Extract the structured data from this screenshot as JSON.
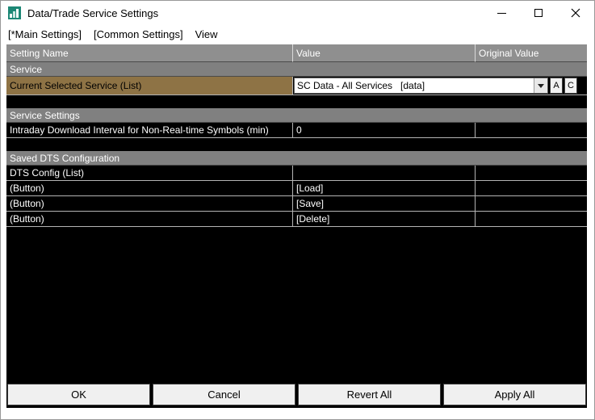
{
  "window": {
    "title": "Data/Trade Service Settings"
  },
  "menu": {
    "items": [
      {
        "label": "[*Main Settings]"
      },
      {
        "label": "[Common Settings]"
      },
      {
        "label": "View"
      }
    ]
  },
  "table": {
    "columns": [
      "Setting Name",
      "Value",
      "Original Value"
    ],
    "rows": [
      {
        "type": "section",
        "label": "Service"
      },
      {
        "type": "setting",
        "name": "Current Selected Service (List)",
        "control": "dropdown",
        "value": "SC Data - All Services   [data]",
        "aux_buttons": [
          "A",
          "C"
        ],
        "original": "",
        "selected": true
      },
      {
        "type": "spacer"
      },
      {
        "type": "section",
        "label": "Service Settings"
      },
      {
        "type": "setting",
        "name": "Intraday Download Interval for Non-Real-time Symbols (min)",
        "value": "0",
        "original": ""
      },
      {
        "type": "spacer"
      },
      {
        "type": "section",
        "label": "Saved DTS Configuration"
      },
      {
        "type": "setting",
        "name": "DTS Config (List)",
        "value": "",
        "original": ""
      },
      {
        "type": "setting",
        "name": "(Button)",
        "value": "[Load]",
        "original": ""
      },
      {
        "type": "setting",
        "name": "(Button)",
        "value": "[Save]",
        "original": ""
      },
      {
        "type": "setting",
        "name": "(Button)",
        "value": "[Delete]",
        "original": ""
      }
    ]
  },
  "footer": {
    "buttons": [
      "OK",
      "Cancel",
      "Revert All",
      "Apply All"
    ]
  },
  "colors": {
    "selected_row_bg": "#8e7345",
    "section_header_bg": "#808080",
    "column_header_bg": "#8f8f8f",
    "row_bg": "#000000",
    "row_text": "#ffffff",
    "app_icon": "#1d8876"
  }
}
